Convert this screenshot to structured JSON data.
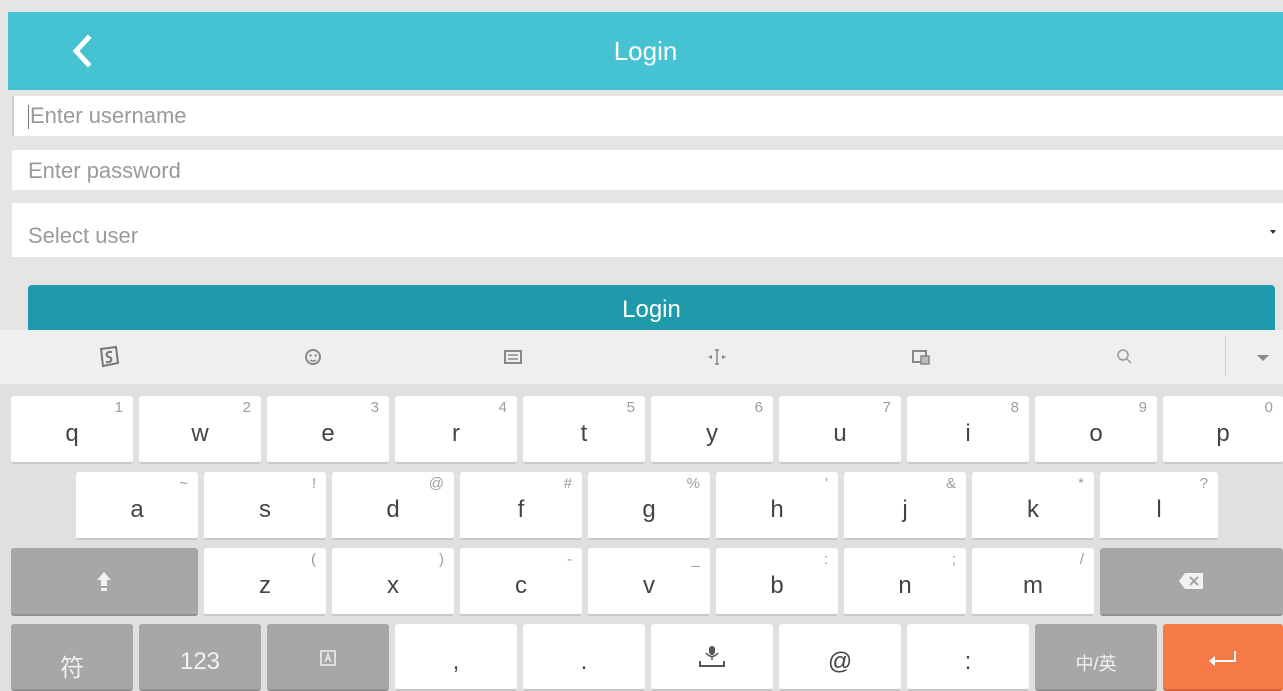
{
  "header": {
    "title": "Login",
    "back_icon": "chevron-left-icon",
    "background": "#45c3d2"
  },
  "form": {
    "username_placeholder": "Enter username",
    "password_placeholder": "Enter password",
    "select_placeholder": "Select user",
    "login_label": "Login",
    "login_color": "#1f9aaa"
  },
  "ime_toolbar": {
    "icons": [
      "sogou-logo-icon",
      "emoji-icon",
      "keyboard-icon",
      "cursor-move-icon",
      "clipboard-icon",
      "search-icon",
      "collapse-arrow-icon"
    ]
  },
  "keyboard": {
    "row1": [
      {
        "key": "q",
        "hint": "1"
      },
      {
        "key": "w",
        "hint": "2"
      },
      {
        "key": "e",
        "hint": "3"
      },
      {
        "key": "r",
        "hint": "4"
      },
      {
        "key": "t",
        "hint": "5"
      },
      {
        "key": "y",
        "hint": "6"
      },
      {
        "key": "u",
        "hint": "7"
      },
      {
        "key": "i",
        "hint": "8"
      },
      {
        "key": "o",
        "hint": "9"
      },
      {
        "key": "p",
        "hint": "0"
      }
    ],
    "row2": [
      {
        "key": "a",
        "hint": "~"
      },
      {
        "key": "s",
        "hint": "!"
      },
      {
        "key": "d",
        "hint": "@"
      },
      {
        "key": "f",
        "hint": "#"
      },
      {
        "key": "g",
        "hint": "%"
      },
      {
        "key": "h",
        "hint": "'"
      },
      {
        "key": "j",
        "hint": "&"
      },
      {
        "key": "k",
        "hint": "*"
      },
      {
        "key": "l",
        "hint": "?"
      }
    ],
    "row3": [
      {
        "key": "z",
        "hint": "("
      },
      {
        "key": "x",
        "hint": ")"
      },
      {
        "key": "c",
        "hint": "-"
      },
      {
        "key": "v",
        "hint": "_"
      },
      {
        "key": "b",
        "hint": ":"
      },
      {
        "key": "n",
        "hint": ";"
      },
      {
        "key": "m",
        "hint": "/"
      }
    ],
    "row4": {
      "symbols": "符",
      "numbers": "123",
      "comma": ",",
      "period": ".",
      "at": "@",
      "colon": ":",
      "lang": "中/英"
    },
    "enter_color": "#f57a46"
  }
}
